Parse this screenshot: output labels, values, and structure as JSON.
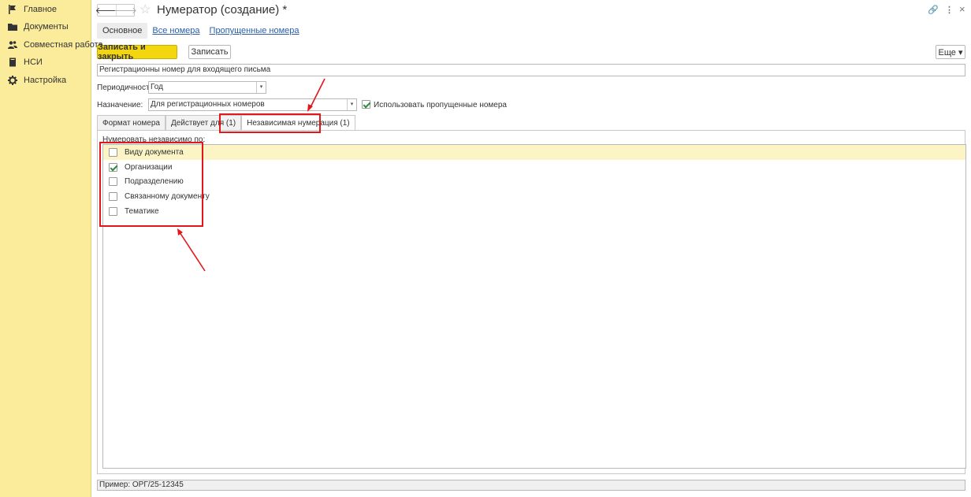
{
  "sidebar": {
    "items": [
      {
        "label": "Главное",
        "icon": "flag-icon"
      },
      {
        "label": "Документы",
        "icon": "folder-icon"
      },
      {
        "label": "Совместная работа",
        "icon": "users-icon"
      },
      {
        "label": "НСИ",
        "icon": "book-icon"
      },
      {
        "label": "Настройка",
        "icon": "gear-icon"
      }
    ]
  },
  "header": {
    "back_glyph": "🡐",
    "forward_glyph": "🡒",
    "star_glyph": "☆",
    "title": "Нумератор (создание) *",
    "link_glyph": "🔗",
    "more_glyph": "⋮",
    "close_glyph": "×"
  },
  "top_tabs": {
    "main": "Основное",
    "all_numbers": "Все номера",
    "missed_numbers": "Пропущенные номера"
  },
  "toolbar": {
    "save_close": "Записать и закрыть",
    "save": "Записать",
    "more": "Еще ▾"
  },
  "form": {
    "name_value": "Регистрационны номер для входящего письма",
    "period_label": "Периодичность:",
    "period_value": "Год",
    "purpose_label": "Назначение:",
    "purpose_value": "Для регистрационных номеров",
    "use_missed_label": "Использовать пропущенные номера",
    "use_missed_checked": true,
    "select_arrow": "▾"
  },
  "inner_tabs": [
    "Формат номера",
    "Действует для (1)",
    "Независимая нумерация (1)"
  ],
  "independent": {
    "heading": "Нумеровать независимо по:",
    "rows": [
      {
        "label": "Виду документа",
        "checked": false,
        "selected": true
      },
      {
        "label": "Организации",
        "checked": true,
        "selected": false
      },
      {
        "label": "Подразделению",
        "checked": false,
        "selected": false
      },
      {
        "label": "Связанному документу",
        "checked": false,
        "selected": false
      },
      {
        "label": "Тематике",
        "checked": false,
        "selected": false
      }
    ]
  },
  "example": "Пример: ОРГ/25-12345",
  "colors": {
    "sidebar_bg": "#fbec9c",
    "primary_btn": "#f4d60f",
    "link": "#2b5ea7",
    "highlight": "#e2161b",
    "check": "#2e8b3a"
  }
}
